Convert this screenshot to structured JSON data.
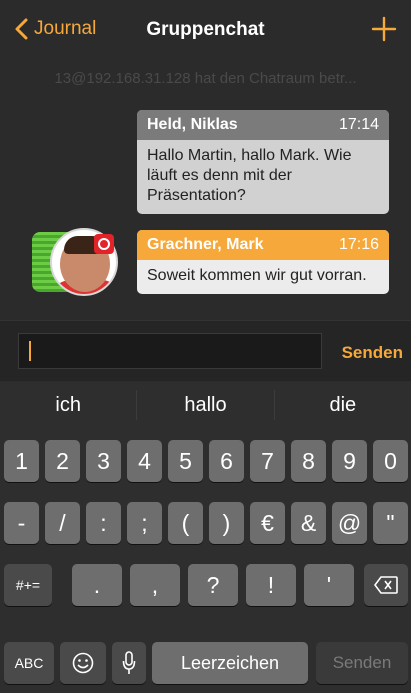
{
  "nav": {
    "back_label": "Journal",
    "title": "Gruppenchat",
    "add_icon": "plus-icon"
  },
  "system_message": "13@192.168.31.128 hat den Chatraum betr...",
  "messages": [
    {
      "sender": "Held, Niklas",
      "time": "17:14",
      "text": "Hallo Martin, hallo Mark. Wie läuft es denn mit der Präsentation?"
    },
    {
      "sender": "Grachner, Mark",
      "time": "17:16",
      "text": "Soweit kommen wir gut vorran."
    }
  ],
  "composer": {
    "value": "",
    "send_label": "Senden"
  },
  "suggestions": [
    "ich",
    "hallo",
    "die"
  ],
  "keyboard": {
    "row1": [
      "1",
      "2",
      "3",
      "4",
      "5",
      "6",
      "7",
      "8",
      "9",
      "0"
    ],
    "row2": [
      "-",
      "/",
      ":",
      ";",
      "(",
      ")",
      "€",
      "&",
      "@",
      "\""
    ],
    "row3_mode": "#+=",
    "row3": [
      ".",
      ",",
      "?",
      "!",
      "'"
    ],
    "row4": {
      "abc": "ABC",
      "space": "Leerzeichen",
      "return": "Senden"
    }
  },
  "colors": {
    "accent": "#f7a83a",
    "background": "#2b2b2b"
  }
}
